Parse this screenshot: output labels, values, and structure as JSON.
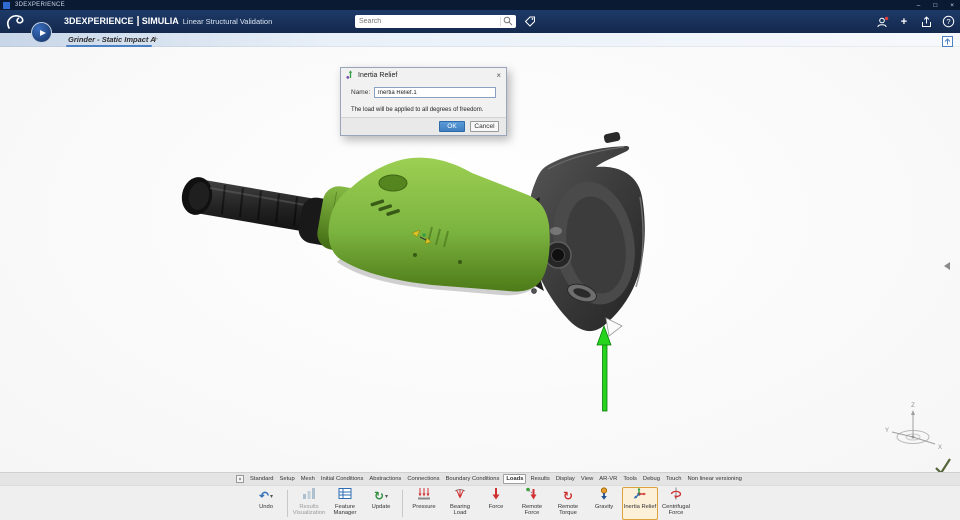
{
  "window": {
    "titlebar_app": "3DEXPERIENCE",
    "controls": {
      "minimize": "–",
      "maximize": "□",
      "close": "×"
    }
  },
  "header": {
    "brand": "3DEXPERIENCE",
    "divider": "|",
    "app": "SIMULIA",
    "subtitle": "Linear Structural Validation",
    "search_placeholder": "Search"
  },
  "workspace_tab": {
    "label": "Grinder - Static Impact A",
    "add_tab": "+"
  },
  "dialog": {
    "title": "Inertia Relief",
    "close": "×",
    "name_label": "Name:",
    "name_value": "Inertia Relief.1",
    "message": "The load will be applied to all degrees of freedom.",
    "ok_label": "OK",
    "cancel_label": "Cancel"
  },
  "viewport": {
    "axis": {
      "x": "X",
      "y": "Y",
      "z": "Z"
    }
  },
  "ribbon": {
    "active_tab": "Loads",
    "tabs": [
      "Standard",
      "Setup",
      "Mesh",
      "Initial Conditions",
      "Abstractions",
      "Connections",
      "Boundary Conditions",
      "Loads",
      "Results",
      "Display",
      "View",
      "AR-VR",
      "Tools",
      "Debug",
      "Touch",
      "Non linear versioning"
    ],
    "buttons": [
      {
        "label": "Undo",
        "dropdown": true
      },
      {
        "label": "Results Visualization",
        "disabled": true
      },
      {
        "label": "Feature Manager"
      },
      {
        "label": "Update",
        "dropdown": true
      },
      {
        "label": "Pressure"
      },
      {
        "label": "Bearing Load"
      },
      {
        "label": "Force"
      },
      {
        "label": "Remote Force"
      },
      {
        "label": "Remote Torque"
      },
      {
        "label": "Gravity"
      },
      {
        "label": "Inertia Relief",
        "active": true
      },
      {
        "label": "Centrifugal Force"
      }
    ]
  },
  "icons": {
    "undo": "↶",
    "update": "↻",
    "remote_torque": "↻",
    "caret": "▾",
    "add": "+",
    "help": "?"
  },
  "colors": {
    "titlebar": "#0b1a33",
    "header_navy": "#17325c",
    "accent_blue": "#4c82c3",
    "ok_button": "#4a90d2",
    "grinder_green": "#7cb440",
    "load_arrow_green": "#24d41e",
    "active_tool_highlight": "#dda23c"
  }
}
